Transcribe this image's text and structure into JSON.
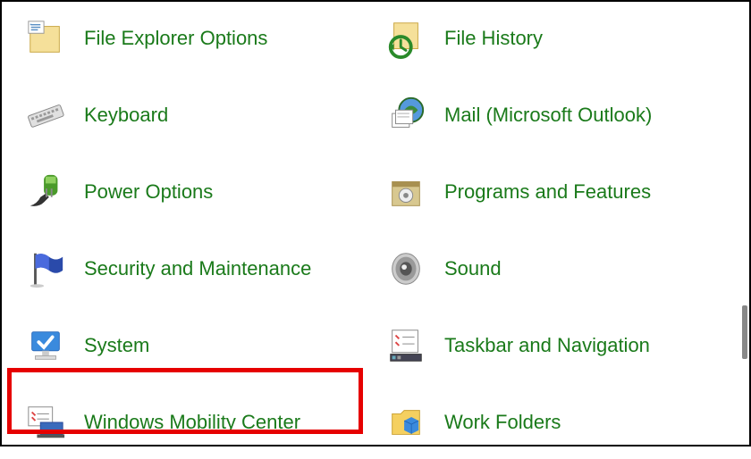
{
  "items": [
    {
      "name": "file-explorer-options",
      "label": "File Explorer Options",
      "icon": "folder-options-icon"
    },
    {
      "name": "file-history",
      "label": "File History",
      "icon": "file-history-icon"
    },
    {
      "name": "keyboard",
      "label": "Keyboard",
      "icon": "keyboard-icon"
    },
    {
      "name": "mail",
      "label": "Mail (Microsoft Outlook)",
      "icon": "mail-icon"
    },
    {
      "name": "power-options",
      "label": "Power Options",
      "icon": "power-plug-icon"
    },
    {
      "name": "programs-and-features",
      "label": "Programs and Features",
      "icon": "programs-icon"
    },
    {
      "name": "security-and-maintenance",
      "label": "Security and Maintenance",
      "icon": "flag-icon"
    },
    {
      "name": "sound",
      "label": "Sound",
      "icon": "speaker-icon"
    },
    {
      "name": "system",
      "label": "System",
      "icon": "monitor-check-icon"
    },
    {
      "name": "taskbar-and-navigation",
      "label": "Taskbar and Navigation",
      "icon": "taskbar-icon"
    },
    {
      "name": "windows-mobility-center",
      "label": "Windows Mobility Center",
      "icon": "mobility-icon"
    },
    {
      "name": "work-folders",
      "label": "Work Folders",
      "icon": "work-folder-icon"
    }
  ],
  "highlighted_index": 10
}
